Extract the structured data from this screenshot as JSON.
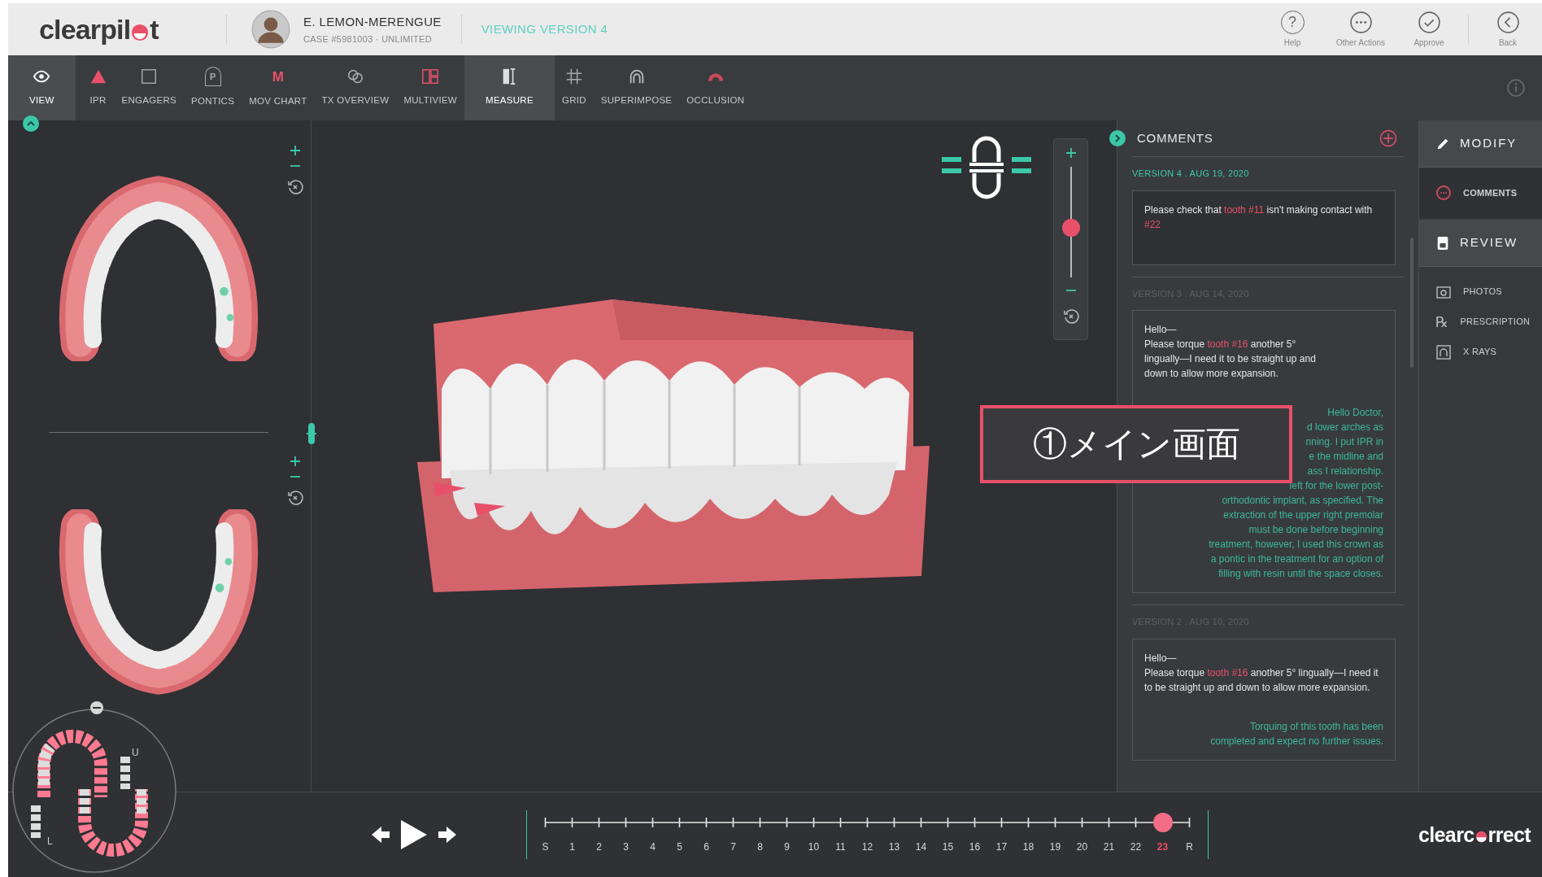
{
  "header": {
    "logo": {
      "before": "clearpil",
      "after": "t"
    },
    "patient_name": "E. LEMON-MERENGUE",
    "case": "CASE #5981003 · UNLIMITED",
    "version_status": "VIEWING VERSION 4",
    "actions": [
      {
        "label": "Help",
        "kind": "help",
        "glyph": "?"
      },
      {
        "label": "Other Actions",
        "kind": "more"
      },
      {
        "label": "Approve",
        "kind": "approve"
      },
      {
        "label": "Back",
        "kind": "back"
      }
    ]
  },
  "toolbar": {
    "tools": [
      {
        "label": "VIEW",
        "kind": "view",
        "selected": true
      },
      {
        "label": "IPR",
        "kind": "ipr",
        "selected": false
      },
      {
        "label": "ENGAGERS",
        "kind": "engagers",
        "selected": false
      },
      {
        "label": "PONTICS",
        "kind": "pontics",
        "glyph": "P",
        "selected": false
      },
      {
        "label": "MOV CHART",
        "kind": "chart",
        "glyph": "M",
        "selected": false
      },
      {
        "label": "TX OVERVIEW",
        "kind": "overview",
        "selected": false
      },
      {
        "label": "MULTIVIEW",
        "kind": "multiview",
        "selected": false
      },
      {
        "label": "MEASURE",
        "kind": "measure",
        "selected": true
      },
      {
        "label": "GRID",
        "kind": "grid",
        "selected": false
      },
      {
        "label": "SUPERIMPOSE",
        "kind": "superimpose",
        "selected": false
      },
      {
        "label": "OCCLUSION",
        "kind": "occlusion",
        "selected": false
      }
    ]
  },
  "viewer": {
    "slider": {
      "level": 0.44
    }
  },
  "minimap": {
    "upper_label": "U",
    "lower_label": "L"
  },
  "comments": {
    "title": "COMMENTS",
    "versions": [
      {
        "label": "VERSION 4 . AUG 19, 2020",
        "current": true,
        "entries": [
          {
            "kind": "question",
            "segments": [
              {
                "text": "Please check that ",
                "ref": false
              },
              {
                "text": "tooth #11",
                "ref": true
              },
              {
                "text": " isn't making contact with ",
                "ref": false
              },
              {
                "text": "#22",
                "ref": true
              }
            ]
          }
        ]
      },
      {
        "label": "VERSION 3 . AUG 14, 2020",
        "current": false,
        "entries": [
          {
            "kind": "question",
            "segments": [
              {
                "text": "Hello—\nPlease torque ",
                "ref": false
              },
              {
                "text": "tooth #16",
                "ref": true
              },
              {
                "text": " another 5°\nlingually—I need it to be straight up and\ndown to allow more expansion.",
                "ref": false
              }
            ]
          },
          {
            "kind": "reply",
            "lines": [
              "Hello Doctor,",
              "d lower arches as",
              "nning. I put IPR in",
              "e the midline and",
              "ass I relationship.",
              "left for the lower post-",
              "orthodontic implant, as specified. The",
              "extraction of the upper right premolar",
              "must be done before beginning",
              "treatment, however, I used this crown as",
              "a pontic in the treatment for an option of",
              "filling with resin until the space closes."
            ]
          }
        ]
      },
      {
        "label": "VERSION 2 . AUG 10, 2020",
        "current": false,
        "entries": [
          {
            "kind": "question",
            "segments": [
              {
                "text": "Hello—\nPlease torque ",
                "ref": false
              },
              {
                "text": "tooth #16",
                "ref": true
              },
              {
                "text": " another 5° lingually—I need it to be straight up and down to allow more expansion.",
                "ref": false
              }
            ]
          },
          {
            "kind": "reply",
            "lines": [
              "Torquing of this tooth has been",
              "completed and expect no further issues."
            ]
          }
        ]
      }
    ]
  },
  "side_nav": {
    "sections": [
      {
        "label": "MODIFY",
        "kind": "modify",
        "items": [
          {
            "label": "COMMENTS",
            "kind": "comments",
            "selected": true
          }
        ]
      },
      {
        "label": "REVIEW",
        "kind": "review",
        "items": [
          {
            "label": "PHOTOS",
            "kind": "photos",
            "selected": false
          },
          {
            "label": "PRESCRIPTION",
            "kind": "prescription",
            "glyph": "℞",
            "selected": false
          },
          {
            "label": "X RAYS",
            "kind": "xrays",
            "selected": false
          }
        ]
      }
    ]
  },
  "timeline": {
    "steps": [
      {
        "label": "S",
        "selected": false
      },
      {
        "label": "1",
        "selected": false
      },
      {
        "label": "2",
        "selected": false
      },
      {
        "label": "3",
        "selected": false
      },
      {
        "label": "4",
        "selected": false
      },
      {
        "label": "5",
        "selected": false
      },
      {
        "label": "6",
        "selected": false
      },
      {
        "label": "7",
        "selected": false
      },
      {
        "label": "8",
        "selected": false
      },
      {
        "label": "9",
        "selected": false
      },
      {
        "label": "10",
        "selected": false
      },
      {
        "label": "11",
        "selected": false
      },
      {
        "label": "12",
        "selected": false
      },
      {
        "label": "13",
        "selected": false
      },
      {
        "label": "14",
        "selected": false
      },
      {
        "label": "15",
        "selected": false
      },
      {
        "label": "16",
        "selected": false
      },
      {
        "label": "17",
        "selected": false
      },
      {
        "label": "18",
        "selected": false
      },
      {
        "label": "19",
        "selected": false
      },
      {
        "label": "20",
        "selected": false
      },
      {
        "label": "21",
        "selected": false
      },
      {
        "label": "22",
        "selected": false
      },
      {
        "label": "23",
        "selected": true
      },
      {
        "label": "R",
        "selected": false
      }
    ]
  },
  "brand": {
    "before": "clearc",
    "after": "rrect"
  },
  "callout": {
    "text": "①メイン画面"
  }
}
